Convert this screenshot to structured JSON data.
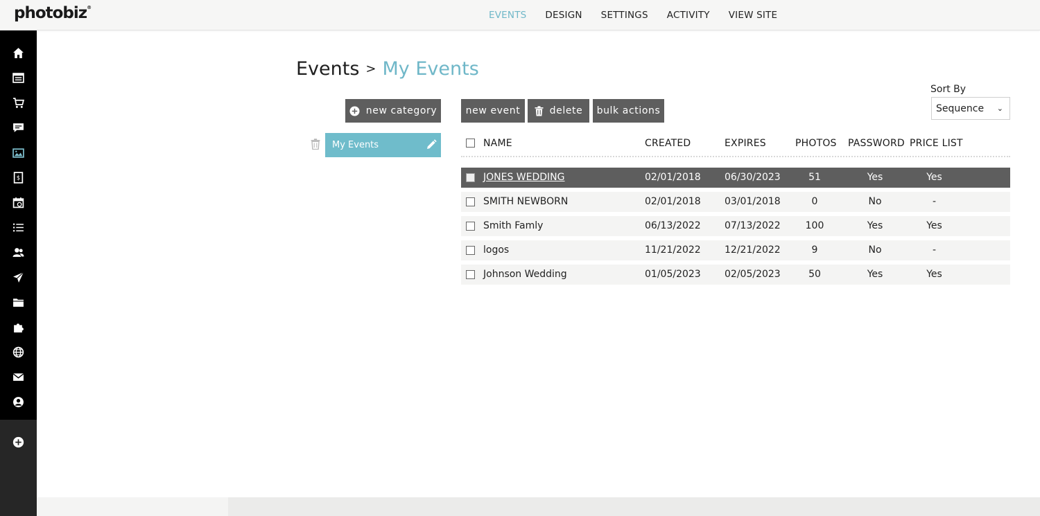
{
  "app": {
    "logo_text": "photobiz",
    "logo_mark": "®"
  },
  "topnav": [
    {
      "label": "EVENTS",
      "active": true
    },
    {
      "label": "DESIGN",
      "active": false
    },
    {
      "label": "SETTINGS",
      "active": false
    },
    {
      "label": "ACTIVITY",
      "active": false
    },
    {
      "label": "VIEW SITE",
      "active": false
    }
  ],
  "sidebar": {
    "icons": [
      "home-icon",
      "website-icon",
      "cart-icon",
      "chat-icon",
      "gallery-icon",
      "invoice-icon",
      "calendar-icon",
      "list-icon",
      "contacts-icon",
      "send-icon",
      "folder-icon",
      "puzzle-icon",
      "globe-icon",
      "mail-icon",
      "account-icon"
    ],
    "add_icon": "plus-circle-icon"
  },
  "breadcrumb": {
    "root": "Events",
    "separator": ">",
    "current": "My Events"
  },
  "buttons": {
    "new_category": "new category",
    "new_event": "new event",
    "delete": "delete",
    "bulk_actions": "bulk actions"
  },
  "sort": {
    "label": "Sort By",
    "selected": "Sequence"
  },
  "categories": [
    {
      "label": "My Events",
      "selected": true
    }
  ],
  "table": {
    "columns": {
      "name": "NAME",
      "created": "CREATED",
      "expires": "EXPIRES",
      "photos": "PHOTOS",
      "password": "PASSWORD",
      "price_list": "PRICE LIST"
    },
    "rows": [
      {
        "name": "JONES WEDDING",
        "created": "02/01/2018",
        "expires": "06/30/2023",
        "photos": "51",
        "password": "Yes",
        "price_list": "Yes",
        "selected": true
      },
      {
        "name": "SMITH NEWBORN",
        "created": "02/01/2018",
        "expires": "03/01/2018",
        "photos": "0",
        "password": "No",
        "price_list": "-",
        "selected": false
      },
      {
        "name": "Smith Famly",
        "created": "06/13/2022",
        "expires": "07/13/2022",
        "photos": "100",
        "password": "Yes",
        "price_list": "Yes",
        "selected": false
      },
      {
        "name": "logos",
        "created": "11/21/2022",
        "expires": "12/21/2022",
        "photos": "9",
        "password": "No",
        "price_list": "-",
        "selected": false
      },
      {
        "name": "Johnson Wedding",
        "created": "01/05/2023",
        "expires": "02/05/2023",
        "photos": "50",
        "password": "Yes",
        "price_list": "Yes",
        "selected": false
      }
    ]
  },
  "colors": {
    "accent": "#6fb7c8",
    "button": "#5e5e5e",
    "sidebar": "#000000"
  }
}
